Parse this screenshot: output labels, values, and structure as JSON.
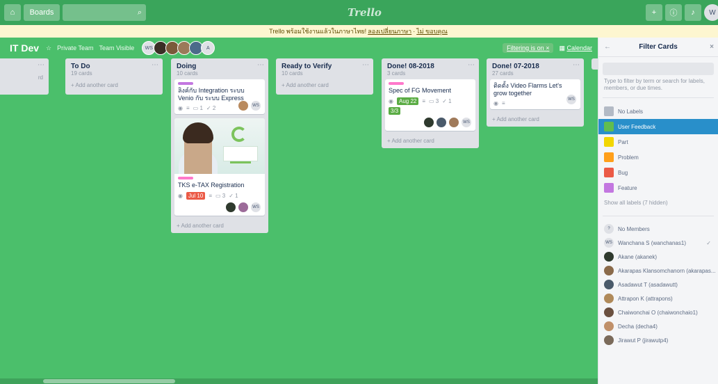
{
  "topbar": {
    "home_icon": "home-icon",
    "boards_label": "Boards",
    "logo": "Trello",
    "add_icon": "plus-icon",
    "info_icon": "info-icon",
    "bell_icon": "bell-icon",
    "user_initials": "W"
  },
  "banner": {
    "text": "Trello พร้อมใช้งานแล้วในภาษาไทย!",
    "link1": "ลองเปลี่ยนภาษา",
    "sep": "·",
    "link2": "ไม่ ขอบคุณ"
  },
  "board": {
    "name": "IT Dev",
    "visibility": "Private Team",
    "team_visible": "Team Visible",
    "members": [
      "WS",
      "",
      "",
      "",
      "",
      "A"
    ],
    "filter_label": "Filtering is on",
    "filter_clear": "×",
    "calendar_label": "Calendar"
  },
  "lists": [
    {
      "title": "",
      "count": "",
      "add": "rd"
    },
    {
      "title": "To Do",
      "count": "19 cards",
      "add": "+ Add another card"
    },
    {
      "title": "Doing",
      "count": "10 cards",
      "add": "+ Add another card",
      "cards": [
        {
          "title": "ลิงค์กับ Integration ระบบ Venio กับ ระบบ Express",
          "badges": [
            "◉",
            "≡",
            "▭ 1",
            "✓ 2"
          ],
          "members": [
            "",
            "WS"
          ]
        },
        {
          "title": "TKS e-TAX Registration",
          "due": "Jul 10",
          "badges": [
            "▭ 3",
            "✓ 1"
          ],
          "members": [
            "",
            "",
            "WS"
          ]
        }
      ]
    },
    {
      "title": "Ready to Verify",
      "count": "10 cards",
      "add": "+ Add another card"
    },
    {
      "title": "Done! 08-2018",
      "count": "3 cards",
      "add": "+ Add another card",
      "cards": [
        {
          "title": "Spec of FG Movement",
          "due": "Aug 22",
          "badges": [
            "▭ 3",
            "✓ 1"
          ],
          "check": "3/3",
          "members": [
            "",
            "",
            "",
            "WS"
          ]
        }
      ]
    },
    {
      "title": "Done! 07-2018",
      "count": "27 cards",
      "add": "+ Add another card",
      "cards": [
        {
          "title": "ติดตั้ง Video Flarms Let's grow together",
          "badges": [
            "◉",
            "≡"
          ],
          "members": [
            "WS"
          ]
        }
      ]
    }
  ],
  "sidebar": {
    "title": "Filter Cards",
    "help": "Type to filter by term or search for labels, members, or due times.",
    "labels": [
      {
        "name": "No Labels",
        "color": "#b3bac5"
      },
      {
        "name": "User Feedback",
        "color": "#61bd4f",
        "selected": true
      },
      {
        "name": "Part",
        "color": "#f2d600"
      },
      {
        "name": "Problem",
        "color": "#ff9f1a"
      },
      {
        "name": "Bug",
        "color": "#eb5a46"
      },
      {
        "name": "Feature",
        "color": "#c377e0"
      }
    ],
    "show_all_labels": "Show all labels (7 hidden)",
    "members": [
      {
        "name": "No Members",
        "initials": "?"
      },
      {
        "name": "Wanchana S (wanchanas1)",
        "initials": "WS",
        "checked": true
      },
      {
        "name": "Akane (akanek)",
        "initials": ""
      },
      {
        "name": "Akarapas Klansomchanorn (akarapas...",
        "initials": ""
      },
      {
        "name": "Asadawut T (asadawutt)",
        "initials": ""
      },
      {
        "name": "Attrapon K (attrapons)",
        "initials": ""
      },
      {
        "name": "Chaiwonchai O (chaiwonchaio1)",
        "initials": ""
      },
      {
        "name": "Decha (decha4)",
        "initials": ""
      },
      {
        "name": "Jirawut P (jirawutp4)",
        "initials": ""
      }
    ]
  }
}
